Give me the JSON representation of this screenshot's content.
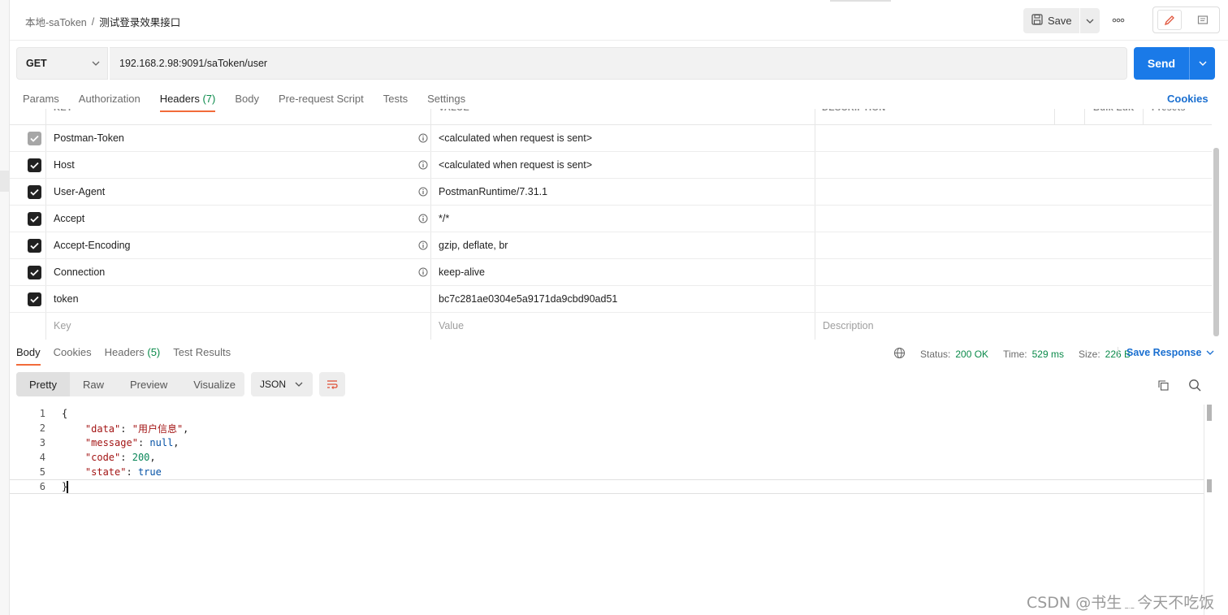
{
  "breadcrumb": {
    "parent": "本地-saToken",
    "separator": "/",
    "current": "测试登录效果接口"
  },
  "header": {
    "save_label": "Save"
  },
  "request": {
    "method": "GET",
    "url": "192.168.2.98:9091/saToken/user",
    "send_label": "Send"
  },
  "request_tabs": [
    {
      "label": "Params"
    },
    {
      "label": "Authorization"
    },
    {
      "label": "Headers",
      "count": "(7)",
      "active": true
    },
    {
      "label": "Body"
    },
    {
      "label": "Pre-request Script"
    },
    {
      "label": "Tests"
    },
    {
      "label": "Settings"
    }
  ],
  "cookies_label": "Cookies",
  "headers_table": {
    "columns": {
      "key": "KEY",
      "value": "VALUE",
      "description": "DESCRIPTION",
      "more": "•••",
      "bulk_edit": "Bulk Edit",
      "presets": "Presets"
    },
    "rows": [
      {
        "key": "Postman-Token",
        "value": "<calculated when request is sent>",
        "checked": true,
        "disabled": true,
        "info": true
      },
      {
        "key": "Host",
        "value": "<calculated when request is sent>",
        "checked": true,
        "info": true
      },
      {
        "key": "User-Agent",
        "value": "PostmanRuntime/7.31.1",
        "checked": true,
        "info": true
      },
      {
        "key": "Accept",
        "value": "*/*",
        "checked": true,
        "info": true
      },
      {
        "key": "Accept-Encoding",
        "value": "gzip, deflate, br",
        "checked": true,
        "info": true
      },
      {
        "key": "Connection",
        "value": "keep-alive",
        "checked": true,
        "info": true
      },
      {
        "key": "token",
        "value": "bc7c281ae0304e5a9171da9cbd90ad51",
        "checked": true,
        "info": false
      }
    ],
    "new_row": {
      "key_placeholder": "Key",
      "value_placeholder": "Value",
      "description_placeholder": "Description"
    }
  },
  "response_tabs": [
    {
      "label": "Body",
      "active": true
    },
    {
      "label": "Cookies"
    },
    {
      "label": "Headers",
      "count": "(5)"
    },
    {
      "label": "Test Results"
    }
  ],
  "response_meta": {
    "status_label": "Status:",
    "status_value": "200 OK",
    "time_label": "Time:",
    "time_value": "529 ms",
    "size_label": "Size:",
    "size_value": "226 B",
    "save_response_label": "Save Response"
  },
  "view_modes": [
    {
      "label": "Pretty",
      "active": true
    },
    {
      "label": "Raw"
    },
    {
      "label": "Preview"
    },
    {
      "label": "Visualize"
    }
  ],
  "format": "JSON",
  "code": {
    "line_numbers": [
      "1",
      "2",
      "3",
      "4",
      "5",
      "6"
    ],
    "open_brace": "{",
    "close_brace": "}",
    "fields": [
      {
        "key": "\"data\"",
        "value": "\"用户信息\"",
        "kind": "s",
        "comma": ","
      },
      {
        "key": "\"message\"",
        "value": "null",
        "kind": "b",
        "comma": ","
      },
      {
        "key": "\"code\"",
        "value": "200",
        "kind": "n",
        "comma": ","
      },
      {
        "key": "\"state\"",
        "value": "true",
        "kind": "b",
        "comma": ""
      }
    ]
  },
  "watermark": "CSDN @书生﹎今天不吃饭",
  "icons": {
    "save": "floppy-disk-icon",
    "more": "ellipsis-icon",
    "edit": "pencil-icon",
    "comment": "comment-icon",
    "info": "info-circle-icon",
    "check": "check-icon",
    "globe": "globe-icon",
    "copy": "copy-icon",
    "search": "search-icon",
    "wrap": "wrap-lines-icon"
  },
  "colors": {
    "send": "#1a7ae8",
    "active_tab": "#f26b3a",
    "ok": "#0a8a4a",
    "link": "#1a6fd0"
  }
}
